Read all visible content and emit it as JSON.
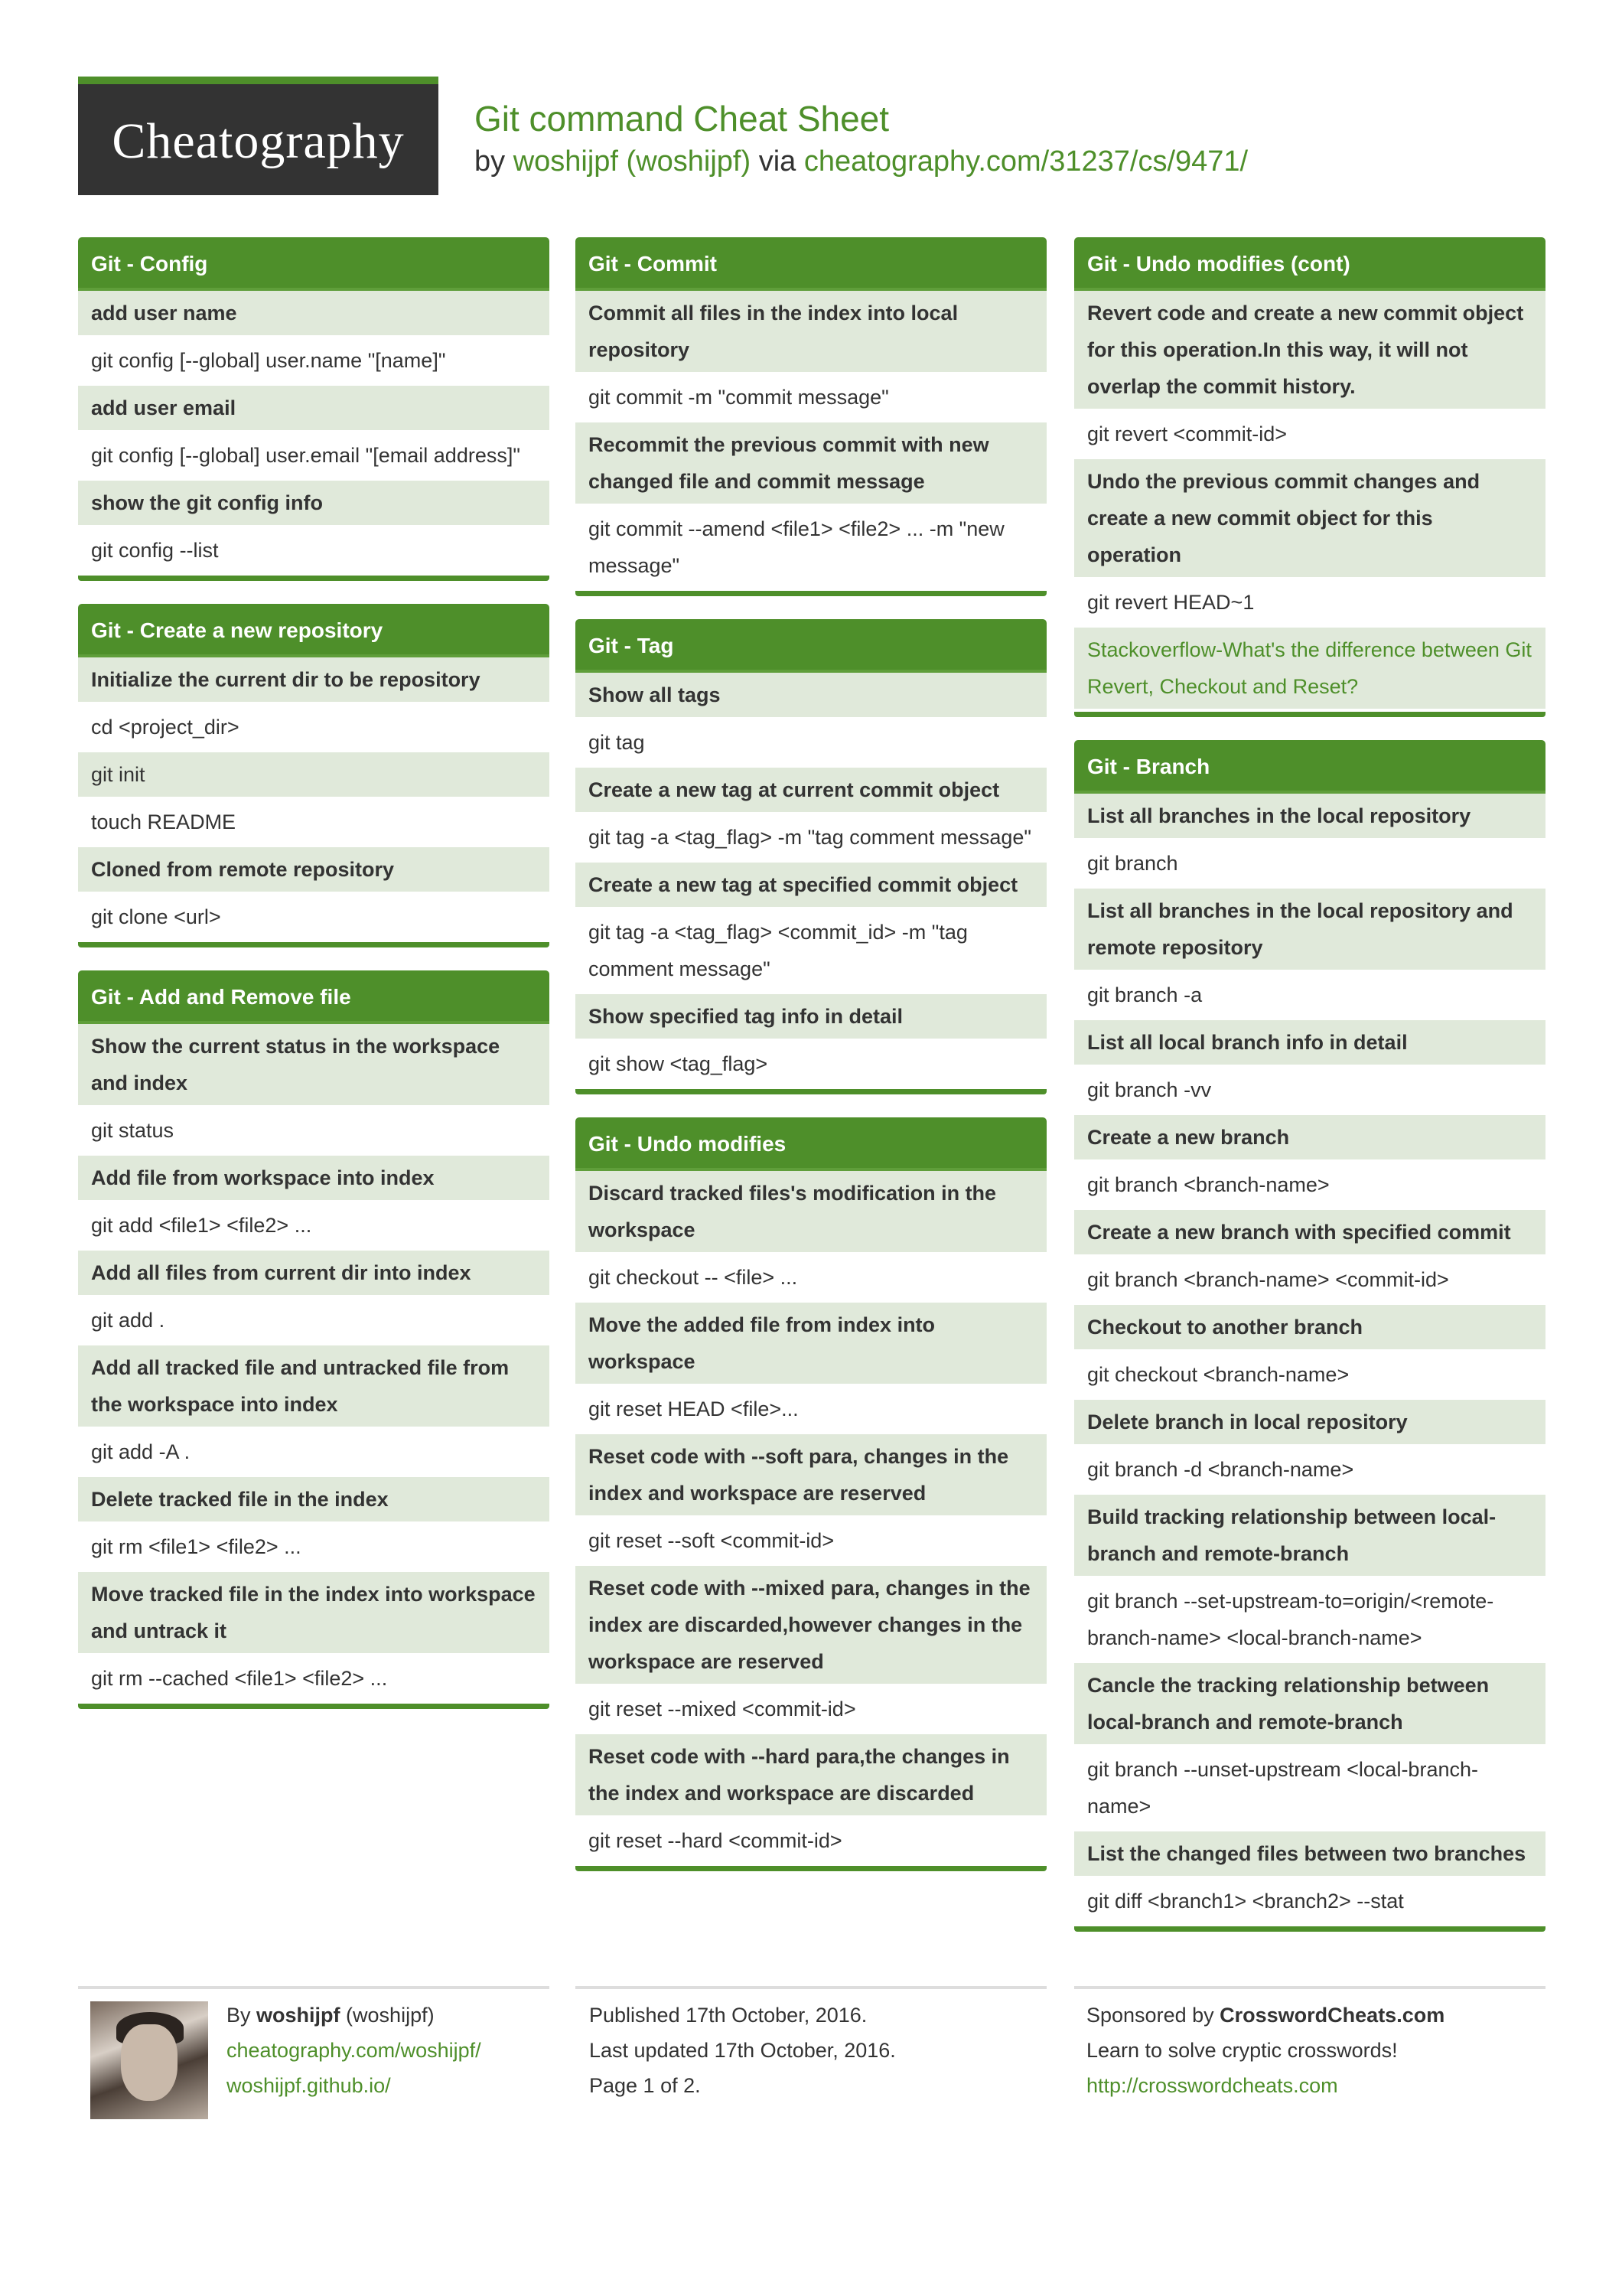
{
  "header": {
    "logo_text": "Cheatography",
    "title": "Git command Cheat Sheet",
    "by": "by",
    "author": "woshijpf (woshijpf)",
    "via": "via",
    "url": "cheatography.com/31237/cs/9471/"
  },
  "sections": {
    "config": {
      "title": "Git - Config",
      "rows": [
        {
          "t": "d",
          "text": "add user name"
        },
        {
          "t": "c",
          "text": "git config [--global] user.name \"[name]\""
        },
        {
          "t": "d",
          "text": "add user email"
        },
        {
          "t": "c",
          "text": "git config [--global] user.email \"[email address]\""
        },
        {
          "t": "d",
          "text": "show the git config info"
        },
        {
          "t": "c",
          "text": "git config --list"
        }
      ]
    },
    "create_repo": {
      "title": "Git - Create a new repository",
      "rows": [
        {
          "t": "d",
          "text": "Initialize the current dir to be repository"
        },
        {
          "t": "c",
          "text": "cd <project_dir>"
        },
        {
          "t": "c",
          "text": "git init",
          "shade": true
        },
        {
          "t": "c",
          "text": "touch README"
        },
        {
          "t": "d",
          "text": "Cloned from remote repository"
        },
        {
          "t": "c",
          "text": "git clone <url>"
        }
      ]
    },
    "add_remove": {
      "title": "Git - Add and Remove file",
      "rows": [
        {
          "t": "d",
          "text": "Show the current status in the workspace and index"
        },
        {
          "t": "c",
          "text": "git status"
        },
        {
          "t": "d",
          "text": "Add file from workspace into index"
        },
        {
          "t": "c",
          "text": "git add <file1> <file2> ..."
        },
        {
          "t": "d",
          "text": "Add all files from current dir into index"
        },
        {
          "t": "c",
          "text": "git add ."
        },
        {
          "t": "d",
          "text": "Add all tracked file and untracked file from the workspace into index"
        },
        {
          "t": "c",
          "text": "git add -A ."
        },
        {
          "t": "d",
          "text": "Delete tracked file in the index"
        },
        {
          "t": "c",
          "text": "git rm <file1> <file2> ..."
        },
        {
          "t": "d",
          "text": "Move tracked file in the index into workspace and untrack it"
        },
        {
          "t": "c",
          "text": "git rm --cached <file1> <file2> ..."
        }
      ]
    },
    "commit": {
      "title": "Git - Commit",
      "rows": [
        {
          "t": "d",
          "text": "Commit all files in the index into local repository"
        },
        {
          "t": "c",
          "text": "git commit -m \"commit message\""
        },
        {
          "t": "d",
          "text": "Recommit the previous commit with new changed file and commit message"
        },
        {
          "t": "c",
          "text": "git commit --amend <file1> <file2> ... -m \"new message\""
        }
      ]
    },
    "tag": {
      "title": "Git - Tag",
      "rows": [
        {
          "t": "d",
          "text": "Show all tags"
        },
        {
          "t": "c",
          "text": "git tag"
        },
        {
          "t": "d",
          "text": "Create a new tag at current commit object"
        },
        {
          "t": "c",
          "text": "git tag -a <tag_flag> -m \"tag comment message\""
        },
        {
          "t": "d",
          "text": "Create a new tag at specified commit object"
        },
        {
          "t": "c",
          "text": "git tag -a <tag_flag> <commit_id> -m \"tag comment message\""
        },
        {
          "t": "d",
          "text": "Show specified tag info in detail"
        },
        {
          "t": "c",
          "text": "git show <tag_flag>"
        }
      ]
    },
    "undo": {
      "title": "Git - Undo modifies",
      "rows": [
        {
          "t": "d",
          "text": "Discard tracked files's modification in the workspace"
        },
        {
          "t": "c",
          "text": "git checkout -- <file> ..."
        },
        {
          "t": "d",
          "text": "Move the added file from index into workspace"
        },
        {
          "t": "c",
          "text": "git reset HEAD <file>..."
        },
        {
          "t": "d",
          "text": "Reset code with --soft para, changes in the index and workspace are reserved"
        },
        {
          "t": "c",
          "text": "git reset --soft <commit-id>"
        },
        {
          "t": "d",
          "text": "Reset code with --mixed para, changes in the index are discarded,however changes in the workspace are reserved"
        },
        {
          "t": "c",
          "text": "git reset --mixed <commit-id>"
        },
        {
          "t": "d",
          "text": "Reset code with --hard para,the changes in the index and workspace are discarded"
        },
        {
          "t": "c",
          "text": "git reset --hard <commit-id>"
        }
      ]
    },
    "undo_cont": {
      "title": "Git - Undo modifies (cont)",
      "rows": [
        {
          "t": "d",
          "text": "Revert code and create a new commit object for this operation.In this way, it will not overlap the commit history."
        },
        {
          "t": "c",
          "text": "git revert <commit-id>"
        },
        {
          "t": "d",
          "text": "Undo the previous commit changes and create a new commit object for this operation"
        },
        {
          "t": "c",
          "text": "git revert HEAD~1"
        },
        {
          "t": "l",
          "text": "Stackoverflow-What's the difference between Git Revert, Checkout and Reset?"
        }
      ]
    },
    "branch": {
      "title": "Git - Branch",
      "rows": [
        {
          "t": "d",
          "text": "List all branches in the local repository"
        },
        {
          "t": "c",
          "text": "git branch"
        },
        {
          "t": "d",
          "text": "List all branches in the local repository and remote repository"
        },
        {
          "t": "c",
          "text": "git branch -a"
        },
        {
          "t": "d",
          "text": "List all local branch info in detail"
        },
        {
          "t": "c",
          "text": "git branch -vv"
        },
        {
          "t": "d",
          "text": "Create a new branch"
        },
        {
          "t": "c",
          "text": "git branch <branch-name>"
        },
        {
          "t": "d",
          "text": "Create a new branch with specified commit"
        },
        {
          "t": "c",
          "text": "git branch <branch-name> <commit-id>"
        },
        {
          "t": "d",
          "text": "Checkout to another branch"
        },
        {
          "t": "c",
          "text": "git checkout <branch-name>"
        },
        {
          "t": "d",
          "text": "Delete branch in local repository"
        },
        {
          "t": "c",
          "text": "git branch -d <branch-name>"
        },
        {
          "t": "d",
          "text": "Build tracking relationship between local-branch and remote-branch"
        },
        {
          "t": "c",
          "text": "git branch --set-upstream-to=origin/<remote-branch-name> <local-branch-name>"
        },
        {
          "t": "d",
          "text": "Cancle the tracking relationship between local-branch and remote-branch"
        },
        {
          "t": "c",
          "text": "git branch --unset-upstream <local-branch-name>"
        },
        {
          "t": "d",
          "text": "List the changed files between two branches"
        },
        {
          "t": "c",
          "text": "git diff <branch1> <branch2> --stat"
        }
      ]
    }
  },
  "footer": {
    "by_label": "By",
    "author_bold": "woshijpf",
    "author_paren": "(woshijpf)",
    "author_link1": "cheatography.com/woshijpf/",
    "author_link2": "woshijpf.github.io/",
    "published": "Published 17th October, 2016.",
    "updated": "Last updated 17th October, 2016.",
    "page": "Page 1 of 2.",
    "sponsored_label": "Sponsored by",
    "sponsor_name": "CrosswordCheats.com",
    "sponsor_tagline": "Learn to solve cryptic crosswords!",
    "sponsor_url": "http://crosswordcheats.com"
  },
  "colors": {
    "accent": "#4e8f2a",
    "row_shade": "#e0e9da",
    "text": "#333333",
    "logo_bg": "#333333"
  }
}
